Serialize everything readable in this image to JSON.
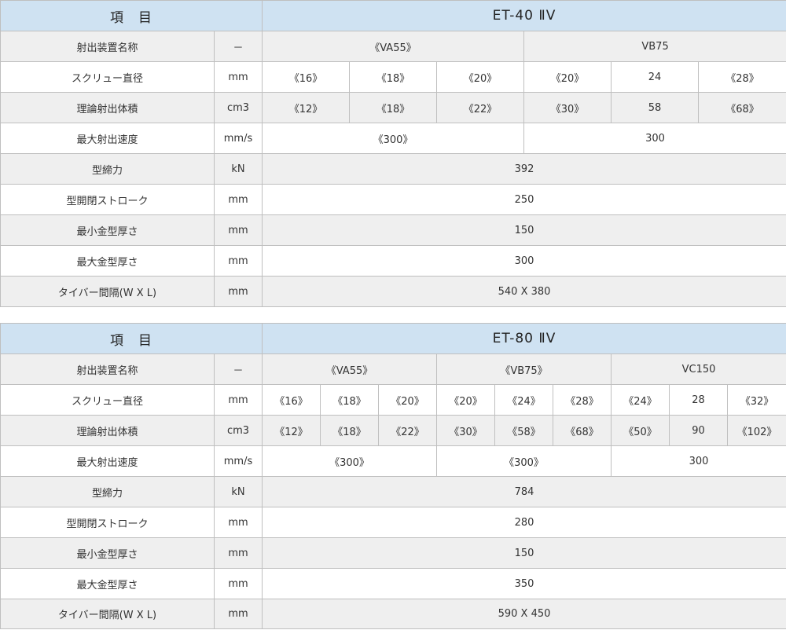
{
  "tables": [
    {
      "item_header": "項　目",
      "model": "ET-40 ⅡV",
      "rows": {
        "injection_unit": {
          "label": "射出装置名称",
          "unit": "－",
          "values": [
            "《VA55》",
            "VB75"
          ]
        },
        "screw_diameter": {
          "label": "スクリュー直径",
          "unit": "mm",
          "values": [
            "《16》",
            "《18》",
            "《20》",
            "《20》",
            "24",
            "《28》"
          ]
        },
        "injection_volume": {
          "label": "理論射出体積",
          "unit": "cm3",
          "values": [
            "《12》",
            "《18》",
            "《22》",
            "《30》",
            "58",
            "《68》"
          ]
        },
        "injection_speed": {
          "label": "最大射出速度",
          "unit": "mm/s",
          "values": [
            "《300》",
            "300"
          ]
        },
        "clamping_force": {
          "label": "型締力",
          "unit": "kN",
          "value": "392"
        },
        "mold_stroke": {
          "label": "型開閉ストローク",
          "unit": "mm",
          "value": "250"
        },
        "min_mold_thickness": {
          "label": "最小金型厚さ",
          "unit": "mm",
          "value": "150"
        },
        "max_mold_thickness": {
          "label": "最大金型厚さ",
          "unit": "mm",
          "value": "300"
        },
        "tie_bar_spacing": {
          "label": "タイバー間隔(W X L)",
          "unit": "mm",
          "value": "540 X 380"
        }
      }
    },
    {
      "item_header": "項　目",
      "model": "ET-80 ⅡV",
      "rows": {
        "injection_unit": {
          "label": "射出装置名称",
          "unit": "－",
          "values": [
            "《VA55》",
            "《VB75》",
            "VC150"
          ]
        },
        "screw_diameter": {
          "label": "スクリュー直径",
          "unit": "mm",
          "values": [
            "《16》",
            "《18》",
            "《20》",
            "《20》",
            "《24》",
            "《28》",
            "《24》",
            "28",
            "《32》"
          ]
        },
        "injection_volume": {
          "label": "理論射出体積",
          "unit": "cm3",
          "values": [
            "《12》",
            "《18》",
            "《22》",
            "《30》",
            "《58》",
            "《68》",
            "《50》",
            "90",
            "《102》"
          ]
        },
        "injection_speed": {
          "label": "最大射出速度",
          "unit": "mm/s",
          "values": [
            "《300》",
            "《300》",
            "300"
          ]
        },
        "clamping_force": {
          "label": "型締力",
          "unit": "kN",
          "value": "784"
        },
        "mold_stroke": {
          "label": "型開閉ストローク",
          "unit": "mm",
          "value": "280"
        },
        "min_mold_thickness": {
          "label": "最小金型厚さ",
          "unit": "mm",
          "value": "150"
        },
        "max_mold_thickness": {
          "label": "最大金型厚さ",
          "unit": "mm",
          "value": "350"
        },
        "tie_bar_spacing": {
          "label": "タイバー間隔(W X L)",
          "unit": "mm",
          "value": "590 X 450"
        }
      }
    }
  ],
  "colors": {
    "header_bg": "#cfe2f2",
    "gray_row": "#efefef",
    "border": "#bfbfbf"
  }
}
